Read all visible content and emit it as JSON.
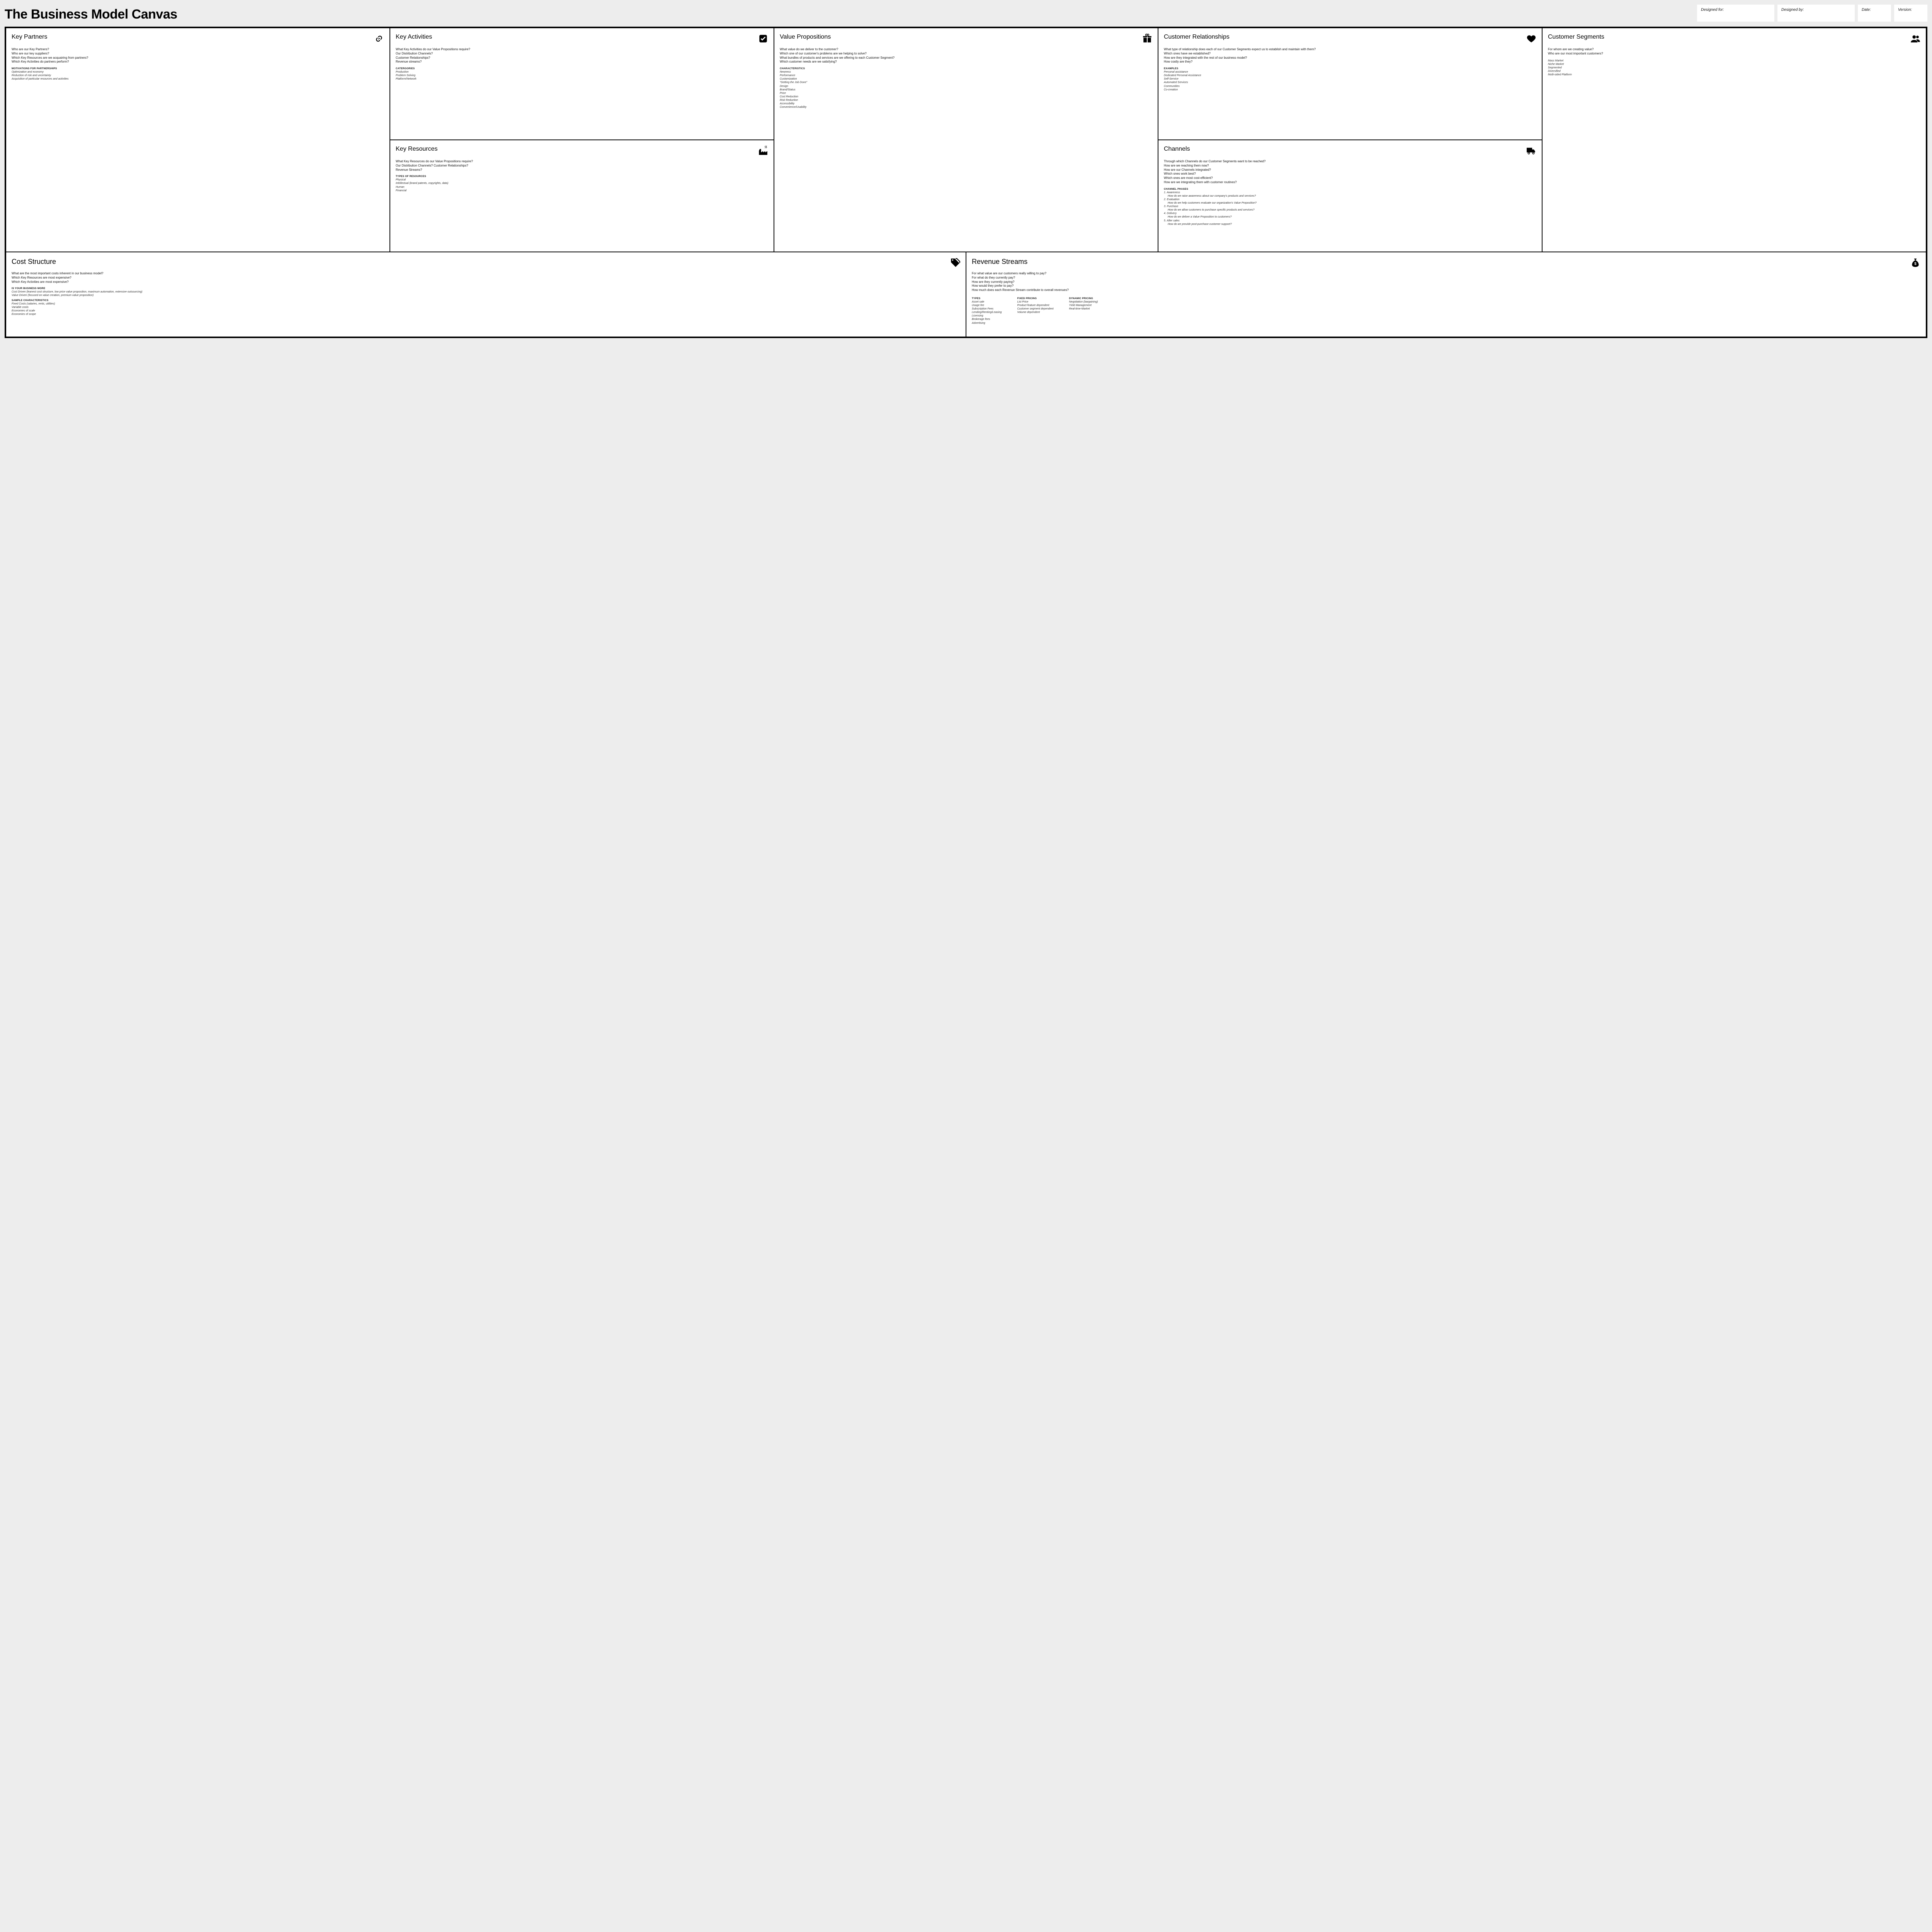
{
  "title": "The Business Model Canvas",
  "meta": {
    "designed_for": "Designed for:",
    "designed_by": "Designed by:",
    "date": "Date:",
    "version": "Version:"
  },
  "kp": {
    "title": "Key Partners",
    "q": [
      "Who are our Key Partners?",
      "Who are our key suppliers?",
      "Which Key Resources are we acquairing from partners?",
      "Which Key Activities do partners perform?"
    ],
    "sub1": "motivations for partnerships",
    "i1": [
      "Optimization and economy",
      "Reduction of risk and uncertainty",
      "Acquisition of particular resources and activities"
    ]
  },
  "ka": {
    "title": "Key Activities",
    "q": [
      "What Key Activities do our Value Propositions require?",
      "Our Distribution Channels?",
      "Customer Relationships?",
      "Revenue streams?"
    ],
    "sub1": "catergories",
    "i1": [
      "Production",
      "Problem Solving",
      "Platform/Network"
    ]
  },
  "kr": {
    "title": "Key Resources",
    "q": [
      "What Key Resources do our Value Propositions require?",
      "Our Distribution Channels? Customer Relationships?",
      "Revenue Streams?"
    ],
    "sub1": "types of resources",
    "i1": [
      "Physical",
      "Intellectual (brand patents, copyrights, data)",
      "Human",
      "Financial"
    ]
  },
  "vp": {
    "title": "Value Propositions",
    "q": [
      "What value do we deliver to the customer?",
      "Which one of our customer's problems are we helping to solve?",
      "What bundles of products and services are we offering to each Customer Segment?",
      "Which customer needs are we satisfying?"
    ],
    "sub1": "characteristics",
    "i1": [
      "Newness",
      "Performance",
      "Customization",
      "\"Getting the Job Done\"",
      "Design",
      "Brand/Status",
      "Price",
      "Cost Reduction",
      "Risk Reduction",
      "Accessibility",
      "Convenience/Usability"
    ]
  },
  "cr": {
    "title": "Customer Relationships",
    "q": [
      "What type of relationship does each of our Customer Segments expect us to establish and maintain with them?",
      "Which ones have we established?",
      "How are they integrated with the rest of our business model?",
      "How costly are they?"
    ],
    "sub1": "examples",
    "i1": [
      "Personal assistance",
      "Dedicated Personal Assistance",
      "Self-Service",
      "Automated Services",
      "Communities",
      "Co-creation"
    ]
  },
  "ch": {
    "title": "Channels",
    "q": [
      "Through which Channels do our Customer Segments want to be reached?",
      "How are we reaching them now?",
      "How are our Channels integrated?",
      "Which ones work best?",
      "Which ones are most cost-efficient?",
      "How are we integrating them with customer routines?"
    ],
    "sub1": "channel phases",
    "phases": [
      {
        "n": "1. Awareness",
        "q": "How do we raise awareness about our company's products and services?"
      },
      {
        "n": "2. Evaluation",
        "q": "How do we help customers evaluate our organization's Value Proposition?"
      },
      {
        "n": "3. Purchase",
        "q": "How do we allow customers to purchase specific products and services?"
      },
      {
        "n": "4. Delivery",
        "q": "How do we deliver a Value Proposition to customers?"
      },
      {
        "n": "5. After sales",
        "q": "How do we provide post-purchase customer support?"
      }
    ]
  },
  "cs": {
    "title": "Customer Segments",
    "q": [
      "For whom are we creating value?",
      "Who are our most important customers?"
    ],
    "i1": [
      "Mass Market",
      "Niche Market",
      "Segmented",
      "Diversified",
      "Multi-sided Platform"
    ]
  },
  "co": {
    "title": "Cost Structure",
    "q": [
      "What are the most important costs inherent in our business model?",
      "Which Key Resources are most expensive?",
      "Which Key Activities are most expensive?"
    ],
    "sub1": "is your business more",
    "i1": [
      "Cost Driven (leanest cost structure, low price value proposition, maximum automation, extensive outsourcing)",
      "Value Driven (focused on value creation, premium value proposition)"
    ],
    "sub2": "sample characteristics",
    "i2": [
      "Fixed Costs (salaries, rents, utilities)",
      "Variable costs",
      "Economies of scale",
      "Economies of scope"
    ]
  },
  "rs": {
    "title": "Revenue Streams",
    "q": [
      "For what value are our customers really willing to pay?",
      "For what do they currently pay?",
      "How are they currently paying?",
      "How would they prefer to pay?",
      "How much does each Revenue Stream contribute to overall revenues?"
    ],
    "g1h": "types",
    "g1": [
      "Asset sale",
      "Usage fee",
      "Subscription Fees",
      "Lending/Renting/Leasing",
      "Licensing",
      "Brokerage fees",
      "Advertising"
    ],
    "g2h": "fixed pricing",
    "g2": [
      "List Price",
      "Product feature dependent",
      "Customer segment dependent",
      "Volume dependent"
    ],
    "g3h": "dynamic pricing",
    "g3": [
      "Negotiation (bargaining)",
      "Yield Management",
      "Real-time-Market"
    ]
  }
}
